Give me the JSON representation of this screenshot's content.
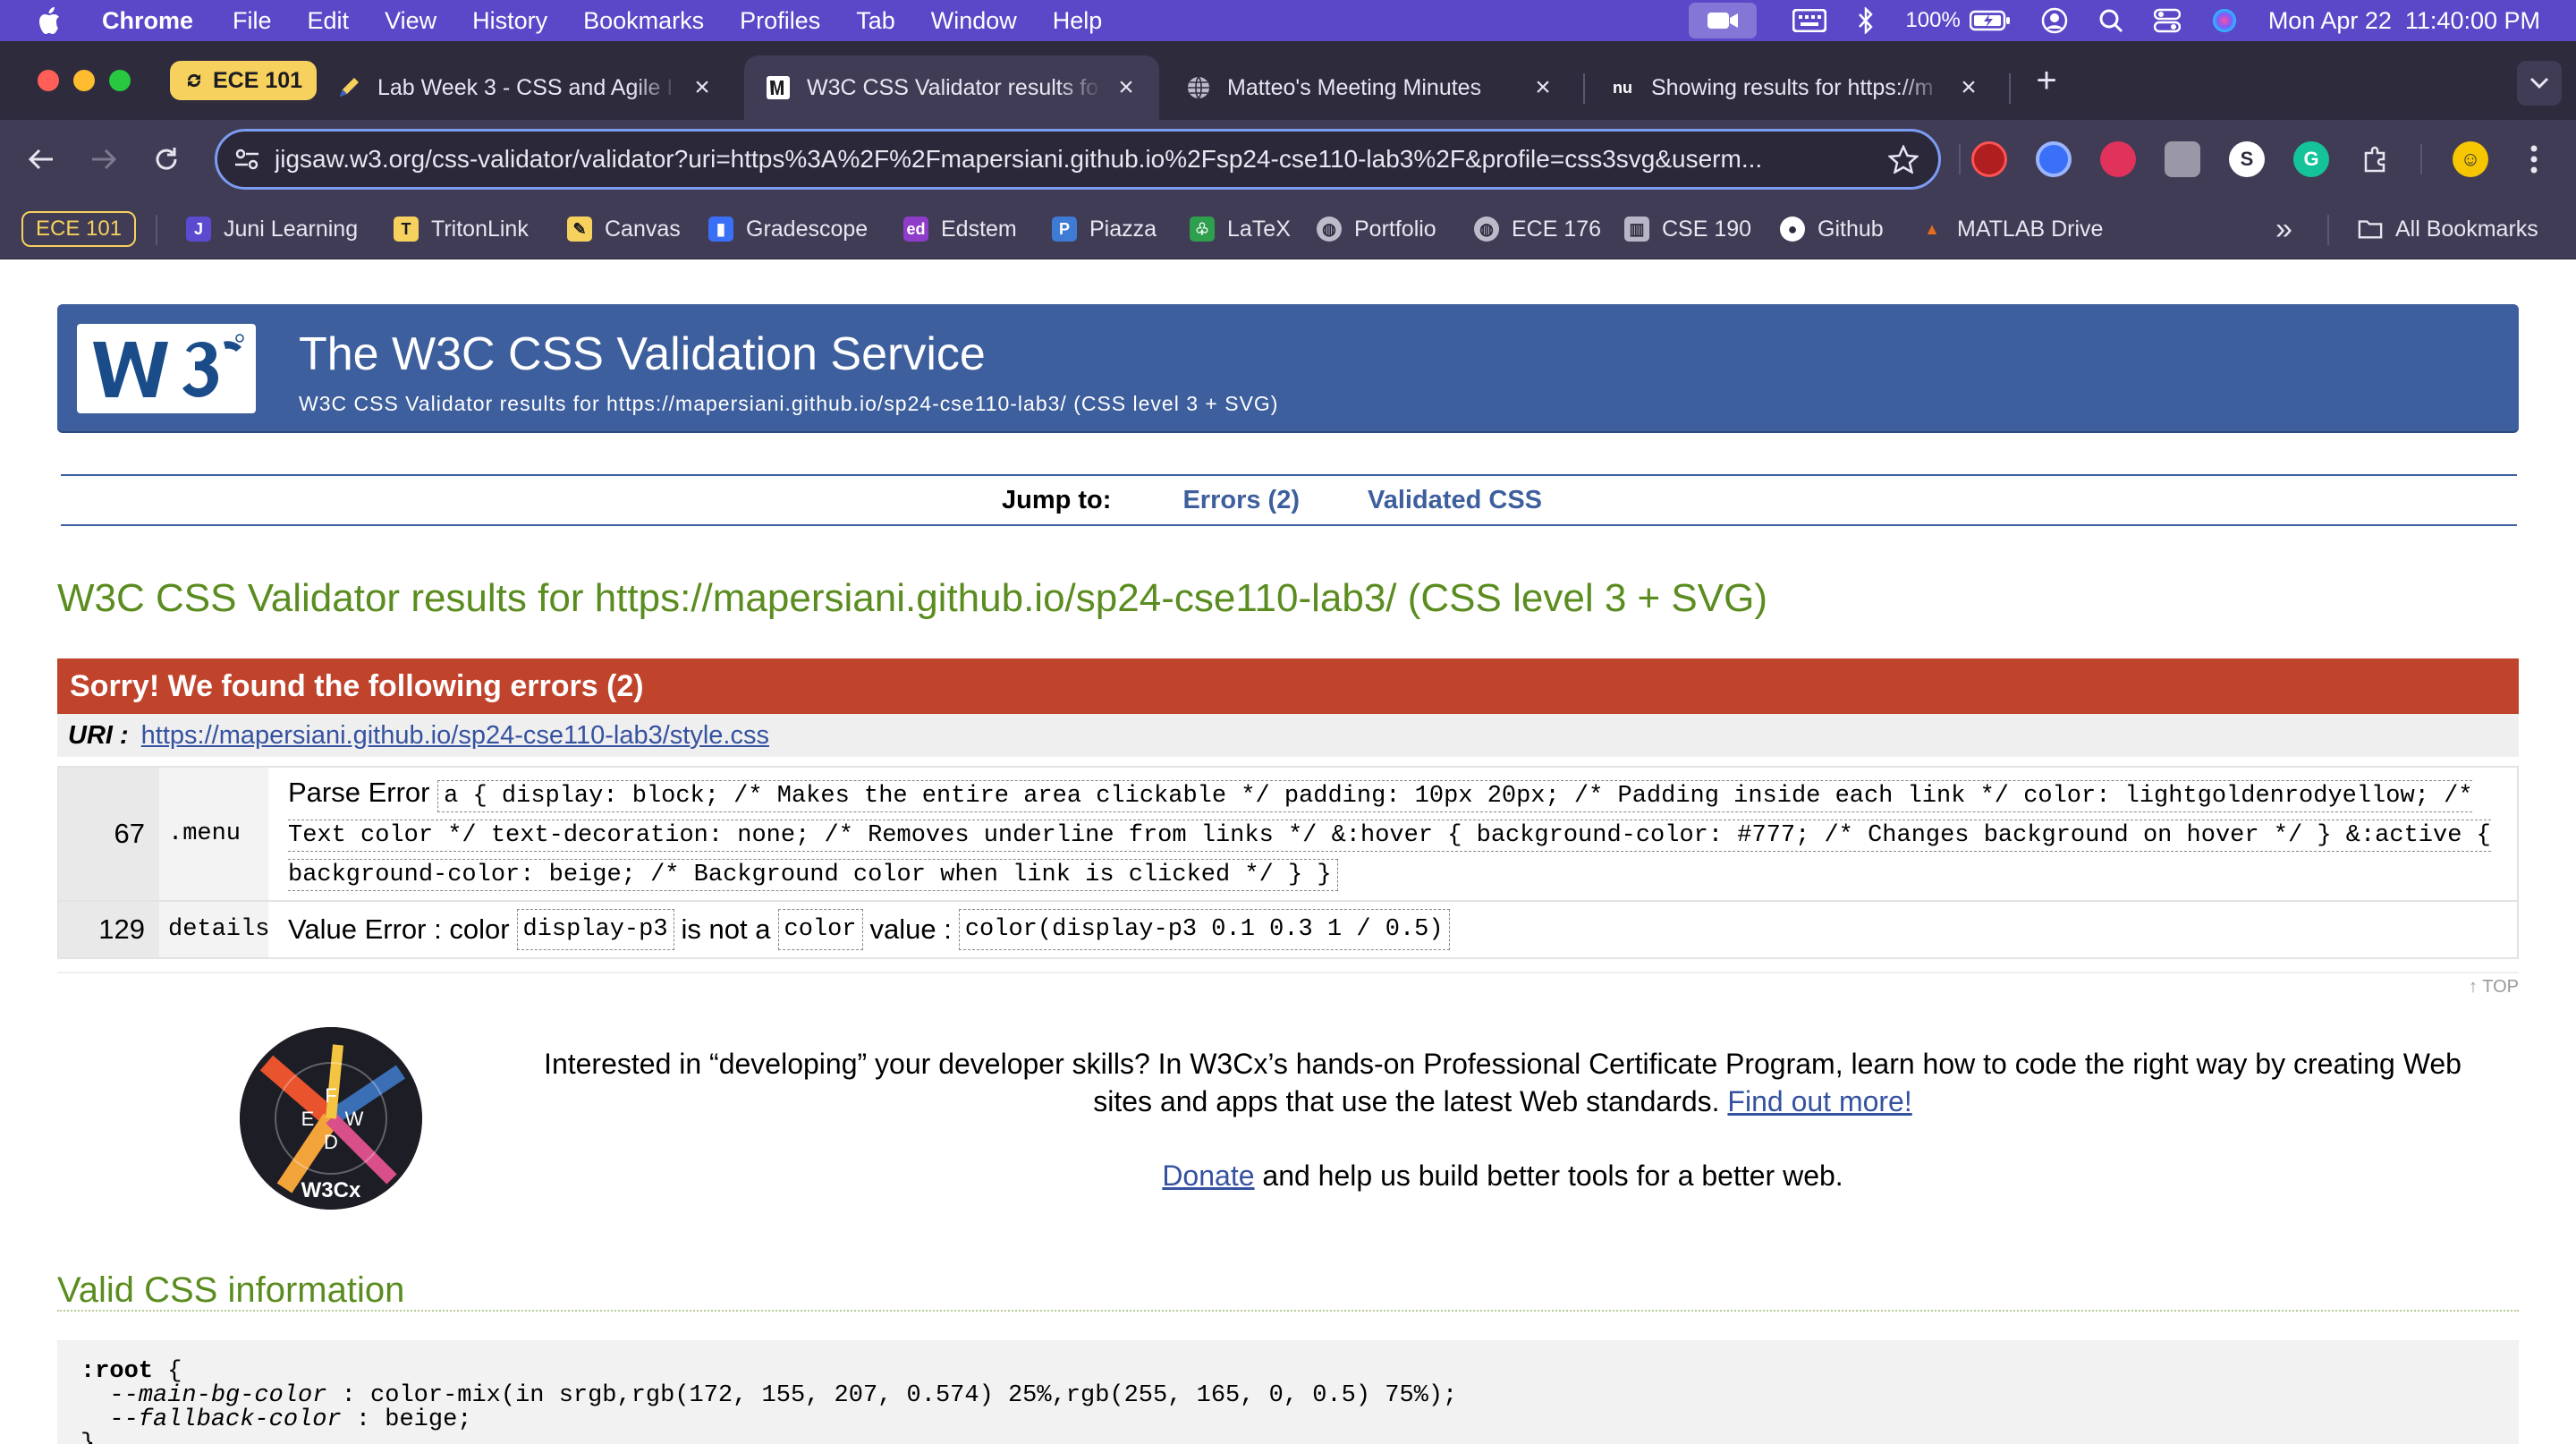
{
  "menubar": {
    "app": "Chrome",
    "items": [
      "File",
      "Edit",
      "View",
      "History",
      "Bookmarks",
      "Profiles",
      "Tab",
      "Window",
      "Help"
    ],
    "battery": "100%",
    "datetime": "Mon Apr 22  11:40:00 PM"
  },
  "tabs": {
    "group_label": "ECE 101",
    "list": [
      {
        "title": "Lab Week 3 - CSS and Agile I"
      },
      {
        "title": "W3C CSS Validator results fo"
      },
      {
        "title": "Matteo's Meeting Minutes"
      },
      {
        "title": "Showing results for https://m"
      }
    ],
    "close_glyph": "×",
    "new_tab": "+"
  },
  "toolbar": {
    "url": "jigsaw.w3.org/css-validator/validator?uri=https%3A%2F%2Fmapersiani.github.io%2Fsp24-cse110-lab3%2F&profile=css3svg&userm..."
  },
  "bookmarks": {
    "group": "ECE 101",
    "items": [
      "Juni Learning",
      "TritonLink",
      "Canvas",
      "Gradescope",
      "Edstem",
      "Piazza",
      "LaTeX",
      "Portfolio",
      "ECE 176",
      "CSE 190",
      "Github",
      "MATLAB Drive"
    ],
    "overflow": "»",
    "all": "All Bookmarks"
  },
  "page": {
    "banner_title": "The W3C CSS Validation Service",
    "banner_subtitle": "W3C CSS Validator results for https://mapersiani.github.io/sp24-cse110-lab3/ (CSS level 3 + SVG)",
    "jump_label": "Jump to:",
    "jump_errors": "Errors (2)",
    "jump_validated": "Validated CSS",
    "results_heading": "W3C CSS Validator results for https://mapersiani.github.io/sp24-cse110-lab3/ (CSS level 3 + SVG)",
    "errors_header": "Sorry! We found the following errors (2)",
    "uri_label": "URI :",
    "uri_value": "https://mapersiani.github.io/sp24-cse110-lab3/style.css",
    "errors": [
      {
        "line": "67",
        "context": ".menu",
        "type": "Parse Error",
        "code": "a { display: block; /* Makes the entire area clickable */ padding: 10px 20px; /* Padding inside each link */ color: lightgoldenrodyellow; /* Text color */ text-decoration: none; /* Removes underline from links */ &:hover { background-color: #777; /* Changes background on hover */ } &:active { background-color: beige; /* Background color when link is clicked */ } }"
      },
      {
        "line": "129",
        "context": "details",
        "type": "Value Error : color",
        "code1": "display-p3",
        "mid": "is not a",
        "code2": "color",
        "tail": "value :",
        "code3": "color(display-p3 0.1 0.3 1 / 0.5)"
      }
    ],
    "top_link": "↑ TOP",
    "promo_text": "Interested in “developing” your developer skills? In W3Cx’s hands-on Professional Certificate Program, learn how to code the right way by creating Web sites and apps that use the latest Web standards.",
    "promo_link": "Find out more!",
    "donate_link": "Donate",
    "donate_text": "and help us build better tools for a better web.",
    "valid_heading": "Valid CSS information",
    "css_lines": {
      "selector": ":root",
      "open": " {",
      "prop1": "--main-bg-color",
      "val1": " : color-mix(in srgb,rgb(172, 155, 207, 0.574) 25%,rgb(255, 165, 0, 0.5) 75%);",
      "prop2": "--fallback-color",
      "val2": " : beige;",
      "close": "}"
    }
  },
  "colors": {
    "menubar": "#5a48c8",
    "banner": "#3e5f9d",
    "error_header": "#c0432c",
    "heading_green": "#5a8c1f"
  }
}
